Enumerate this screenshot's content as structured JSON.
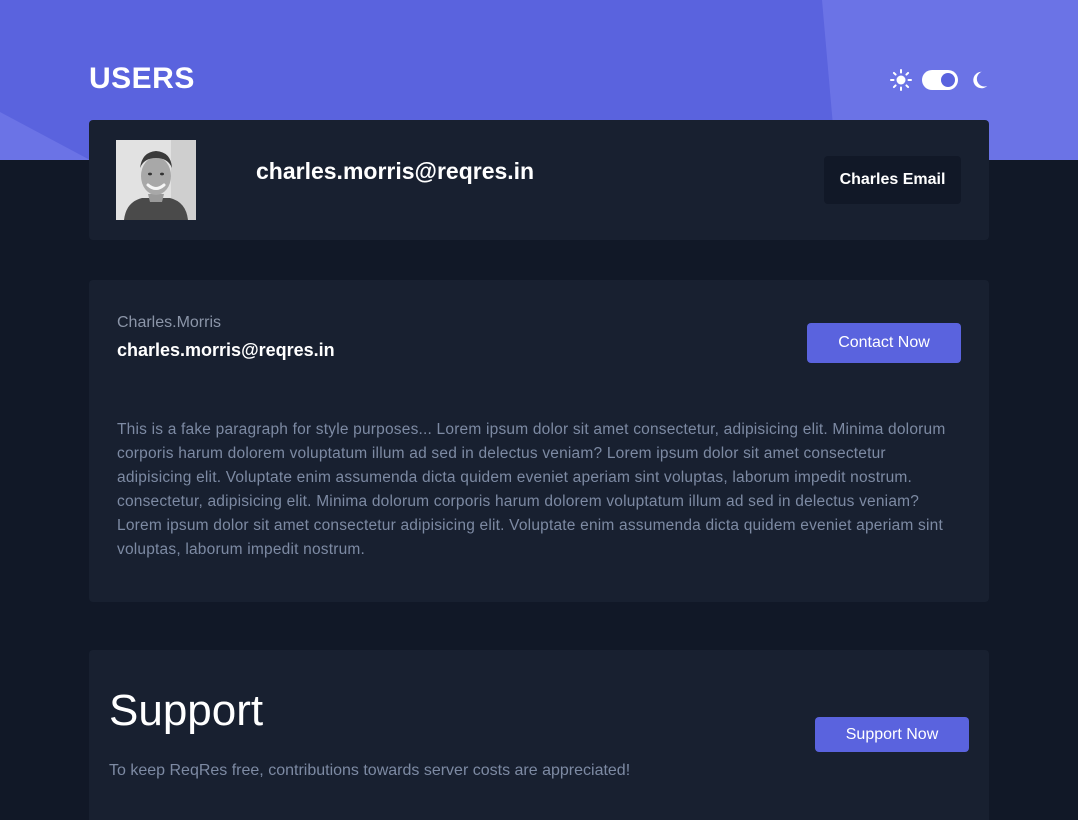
{
  "header": {
    "title": "USERS",
    "theme_toggle": {
      "state": "dark",
      "left_icon": "sun-icon",
      "right_icon": "moon-icon"
    }
  },
  "profile": {
    "email": "charles.morris@reqres.in",
    "email_button_label": "Charles Email",
    "avatar": "avatar-photo"
  },
  "details": {
    "username": "Charles.Morris",
    "email": "charles.morris@reqres.in",
    "contact_button_label": "Contact Now",
    "paragraph": "This is a fake paragraph for style purposes... Lorem ipsum dolor sit amet consectetur, adipisicing elit. Minima dolorum corporis harum dolorem voluptatum illum ad sed in delectus veniam? Lorem ipsum dolor sit amet consectetur adipisicing elit. Voluptate enim assumenda dicta quidem eveniet aperiam sint voluptas, laborum impedit nostrum. consectetur, adipisicing elit. Minima dolorum corporis harum dolorem voluptatum illum ad sed in delectus veniam? Lorem ipsum dolor sit amet consectetur adipisicing elit. Voluptate enim assumenda dicta quidem eveniet aperiam sint voluptas, laborum impedit nostrum."
  },
  "support": {
    "title": "Support",
    "text": "To keep ReqRes free, contributions towards server costs are appreciated!",
    "button_label": "Support Now"
  },
  "colors": {
    "accent": "#5a63de",
    "background": "#111827",
    "card": "#182030",
    "muted_text": "#7d8aa3"
  }
}
